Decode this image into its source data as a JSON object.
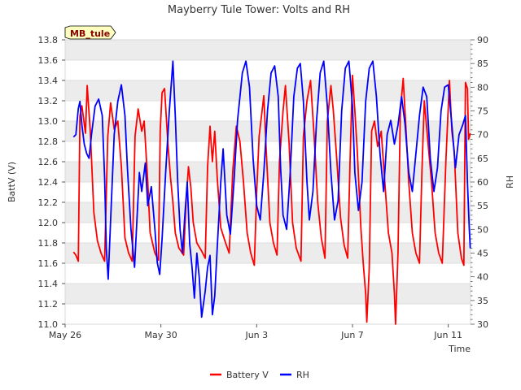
{
  "chart_data": {
    "type": "line",
    "title": "Mayberry Tule Tower: Volts and RH",
    "badge": "MB_tule",
    "xlabel": "Time",
    "ylabel_left": "BattV (V)",
    "ylabel_right": "RH",
    "xlim": [
      "2024-05-26",
      "2024-06-12"
    ],
    "x_ticks": [
      {
        "label": "May 26",
        "day": 0
      },
      {
        "label": "May 30",
        "day": 4
      },
      {
        "label": "Jun 3",
        "day": 8
      },
      {
        "label": "Jun 7",
        "day": 12
      },
      {
        "label": "Jun 11",
        "day": 16
      }
    ],
    "ylim_left": [
      11.0,
      13.8
    ],
    "ylim_right": [
      30,
      90
    ],
    "yticks_left": [
      "11.0",
      "11.2",
      "11.4",
      "11.6",
      "11.8",
      "12.0",
      "12.2",
      "12.4",
      "12.6",
      "12.8",
      "13.0",
      "13.2",
      "13.4",
      "13.6",
      "13.8"
    ],
    "yticks_right": [
      "30",
      "35",
      "40",
      "45",
      "50",
      "55",
      "60",
      "65",
      "70",
      "75",
      "80",
      "85",
      "90"
    ],
    "legend_position": "bottom",
    "colors": {
      "battery": "#ff0000",
      "rh": "#0000ff",
      "band": "#ececec",
      "badge_bg": "#ffffc0"
    },
    "series": [
      {
        "name": "Battery V",
        "axis": "left",
        "color": "#ff0000",
        "points": [
          [
            0.35,
            11.71
          ],
          [
            0.45,
            11.68
          ],
          [
            0.55,
            11.62
          ],
          [
            0.62,
            13.05
          ],
          [
            0.7,
            13.15
          ],
          [
            0.85,
            12.88
          ],
          [
            0.92,
            13.35
          ],
          [
            1.05,
            12.9
          ],
          [
            1.2,
            12.1
          ],
          [
            1.35,
            11.82
          ],
          [
            1.5,
            11.7
          ],
          [
            1.65,
            11.62
          ],
          [
            1.78,
            12.85
          ],
          [
            1.9,
            13.18
          ],
          [
            2.05,
            12.92
          ],
          [
            2.2,
            13.0
          ],
          [
            2.35,
            12.55
          ],
          [
            2.5,
            11.85
          ],
          [
            2.65,
            11.7
          ],
          [
            2.8,
            11.62
          ],
          [
            2.92,
            12.85
          ],
          [
            3.05,
            13.12
          ],
          [
            3.2,
            12.9
          ],
          [
            3.3,
            13.0
          ],
          [
            3.45,
            12.4
          ],
          [
            3.55,
            11.9
          ],
          [
            3.75,
            11.7
          ],
          [
            3.9,
            11.63
          ],
          [
            3.97,
            12.9
          ],
          [
            4.05,
            13.28
          ],
          [
            4.15,
            13.32
          ],
          [
            4.3,
            12.75
          ],
          [
            4.4,
            12.45
          ],
          [
            4.5,
            12.2
          ],
          [
            4.6,
            11.9
          ],
          [
            4.75,
            11.75
          ],
          [
            4.95,
            11.68
          ],
          [
            5.05,
            12.2
          ],
          [
            5.15,
            12.55
          ],
          [
            5.25,
            12.35
          ],
          [
            5.35,
            12.0
          ],
          [
            5.5,
            11.8
          ],
          [
            5.7,
            11.72
          ],
          [
            5.85,
            11.65
          ],
          [
            5.95,
            12.55
          ],
          [
            6.05,
            12.95
          ],
          [
            6.15,
            12.6
          ],
          [
            6.25,
            12.9
          ],
          [
            6.35,
            12.45
          ],
          [
            6.5,
            11.95
          ],
          [
            6.7,
            11.8
          ],
          [
            6.85,
            11.7
          ],
          [
            7.0,
            12.5
          ],
          [
            7.15,
            12.95
          ],
          [
            7.3,
            12.8
          ],
          [
            7.45,
            12.4
          ],
          [
            7.6,
            11.9
          ],
          [
            7.75,
            11.7
          ],
          [
            7.9,
            11.58
          ],
          [
            8.0,
            12.3
          ],
          [
            8.1,
            12.85
          ],
          [
            8.2,
            13.05
          ],
          [
            8.3,
            13.25
          ],
          [
            8.4,
            12.7
          ],
          [
            8.55,
            12.0
          ],
          [
            8.7,
            11.8
          ],
          [
            8.85,
            11.68
          ],
          [
            8.95,
            12.6
          ],
          [
            9.1,
            13.1
          ],
          [
            9.2,
            13.35
          ],
          [
            9.35,
            12.8
          ],
          [
            9.5,
            12.0
          ],
          [
            9.65,
            11.75
          ],
          [
            9.85,
            11.62
          ],
          [
            9.95,
            12.85
          ],
          [
            10.1,
            13.2
          ],
          [
            10.25,
            13.4
          ],
          [
            10.4,
            12.85
          ],
          [
            10.55,
            12.2
          ],
          [
            10.7,
            11.85
          ],
          [
            10.85,
            11.65
          ],
          [
            10.95,
            13.0
          ],
          [
            11.1,
            13.35
          ],
          [
            11.2,
            13.1
          ],
          [
            11.35,
            12.6
          ],
          [
            11.5,
            12.05
          ],
          [
            11.65,
            11.78
          ],
          [
            11.8,
            11.65
          ],
          [
            11.9,
            12.6
          ],
          [
            12.0,
            13.45
          ],
          [
            12.1,
            13.1
          ],
          [
            12.2,
            12.7
          ],
          [
            12.35,
            11.95
          ],
          [
            12.45,
            11.6
          ],
          [
            12.55,
            11.3
          ],
          [
            12.6,
            11.02
          ],
          [
            12.7,
            11.55
          ],
          [
            12.8,
            12.9
          ],
          [
            12.92,
            13.0
          ],
          [
            13.05,
            12.75
          ],
          [
            13.2,
            12.9
          ],
          [
            13.35,
            12.4
          ],
          [
            13.5,
            11.9
          ],
          [
            13.65,
            11.7
          ],
          [
            13.75,
            11.3
          ],
          [
            13.8,
            11.0
          ],
          [
            13.9,
            11.7
          ],
          [
            14.0,
            13.1
          ],
          [
            14.12,
            13.42
          ],
          [
            14.25,
            12.85
          ],
          [
            14.35,
            12.4
          ],
          [
            14.5,
            11.9
          ],
          [
            14.65,
            11.7
          ],
          [
            14.8,
            11.6
          ],
          [
            14.9,
            12.5
          ],
          [
            15.0,
            13.2
          ],
          [
            15.15,
            12.8
          ],
          [
            15.3,
            12.4
          ],
          [
            15.45,
            11.9
          ],
          [
            15.6,
            11.7
          ],
          [
            15.75,
            11.6
          ],
          [
            15.9,
            12.6
          ],
          [
            16.05,
            13.4
          ],
          [
            16.15,
            12.9
          ],
          [
            16.25,
            12.7
          ],
          [
            16.4,
            11.9
          ],
          [
            16.55,
            11.65
          ],
          [
            16.65,
            11.58
          ],
          [
            16.72,
            13.38
          ],
          [
            16.8,
            13.32
          ],
          [
            16.85,
            12.82
          ],
          [
            16.92,
            12.88
          ]
        ]
      },
      {
        "name": "RH",
        "axis": "right",
        "color": "#0000ff",
        "points": [
          [
            0.35,
            69.5
          ],
          [
            0.45,
            70.0
          ],
          [
            0.55,
            75.5
          ],
          [
            0.62,
            77.0
          ],
          [
            0.7,
            72.0
          ],
          [
            0.8,
            68.0
          ],
          [
            0.9,
            66.0
          ],
          [
            1.0,
            65.0
          ],
          [
            1.1,
            70.0
          ],
          [
            1.25,
            76.0
          ],
          [
            1.4,
            77.5
          ],
          [
            1.55,
            74.0
          ],
          [
            1.65,
            61.0
          ],
          [
            1.72,
            46.0
          ],
          [
            1.8,
            39.5
          ],
          [
            1.9,
            52.0
          ],
          [
            2.05,
            70.0
          ],
          [
            2.2,
            77.0
          ],
          [
            2.35,
            80.5
          ],
          [
            2.5,
            74.0
          ],
          [
            2.6,
            63.0
          ],
          [
            2.75,
            50.0
          ],
          [
            2.9,
            42.0
          ],
          [
            3.0,
            52.0
          ],
          [
            3.1,
            62.0
          ],
          [
            3.2,
            58.0
          ],
          [
            3.35,
            64.0
          ],
          [
            3.45,
            55.0
          ],
          [
            3.6,
            59.0
          ],
          [
            3.75,
            50.0
          ],
          [
            3.85,
            43.0
          ],
          [
            3.95,
            40.5
          ],
          [
            4.05,
            48.0
          ],
          [
            4.2,
            62.0
          ],
          [
            4.35,
            75.0
          ],
          [
            4.5,
            85.5
          ],
          [
            4.6,
            74.0
          ],
          [
            4.7,
            60.0
          ],
          [
            4.8,
            50.0
          ],
          [
            4.9,
            45.0
          ],
          [
            5.0,
            53.0
          ],
          [
            5.1,
            60.0
          ],
          [
            5.2,
            47.0
          ],
          [
            5.3,
            42.0
          ],
          [
            5.4,
            35.5
          ],
          [
            5.5,
            45.0
          ],
          [
            5.6,
            40.0
          ],
          [
            5.7,
            31.5
          ],
          [
            5.85,
            37.0
          ],
          [
            5.95,
            42.0
          ],
          [
            6.05,
            44.5
          ],
          [
            6.15,
            32.0
          ],
          [
            6.25,
            36.0
          ],
          [
            6.35,
            46.0
          ],
          [
            6.5,
            60.0
          ],
          [
            6.6,
            67.0
          ],
          [
            6.75,
            53.0
          ],
          [
            6.9,
            49.0
          ],
          [
            7.05,
            60.0
          ],
          [
            7.2,
            73.0
          ],
          [
            7.4,
            83.0
          ],
          [
            7.55,
            85.5
          ],
          [
            7.7,
            80.0
          ],
          [
            7.85,
            65.0
          ],
          [
            8.0,
            55.0
          ],
          [
            8.15,
            52.0
          ],
          [
            8.3,
            62.0
          ],
          [
            8.45,
            75.0
          ],
          [
            8.6,
            83.0
          ],
          [
            8.75,
            84.5
          ],
          [
            8.9,
            78.0
          ],
          [
            9.0,
            63.0
          ],
          [
            9.1,
            53.0
          ],
          [
            9.25,
            50.0
          ],
          [
            9.4,
            62.0
          ],
          [
            9.55,
            78.0
          ],
          [
            9.7,
            84.0
          ],
          [
            9.82,
            85.0
          ],
          [
            9.95,
            77.0
          ],
          [
            10.1,
            60.0
          ],
          [
            10.2,
            52.0
          ],
          [
            10.35,
            58.0
          ],
          [
            10.5,
            73.0
          ],
          [
            10.65,
            83.0
          ],
          [
            10.8,
            85.5
          ],
          [
            10.95,
            76.0
          ],
          [
            11.1,
            62.0
          ],
          [
            11.25,
            52.0
          ],
          [
            11.4,
            56.0
          ],
          [
            11.55,
            75.0
          ],
          [
            11.7,
            84.0
          ],
          [
            11.85,
            85.5
          ],
          [
            12.0,
            76.0
          ],
          [
            12.1,
            62.0
          ],
          [
            12.25,
            54.0
          ],
          [
            12.4,
            60.0
          ],
          [
            12.55,
            77.0
          ],
          [
            12.7,
            84.0
          ],
          [
            12.85,
            85.5
          ],
          [
            13.0,
            78.0
          ],
          [
            13.15,
            66.0
          ],
          [
            13.3,
            58.0
          ],
          [
            13.45,
            70.0
          ],
          [
            13.6,
            73.0
          ],
          [
            13.75,
            68.0
          ],
          [
            13.9,
            72.0
          ],
          [
            14.05,
            78.0
          ],
          [
            14.2,
            72.0
          ],
          [
            14.35,
            62.0
          ],
          [
            14.5,
            58.0
          ],
          [
            14.65,
            66.0
          ],
          [
            14.8,
            74.0
          ],
          [
            14.95,
            80.0
          ],
          [
            15.1,
            78.0
          ],
          [
            15.25,
            65.0
          ],
          [
            15.4,
            58.0
          ],
          [
            15.55,
            63.0
          ],
          [
            15.7,
            75.0
          ],
          [
            15.85,
            80.0
          ],
          [
            16.0,
            80.5
          ],
          [
            16.15,
            72.0
          ],
          [
            16.3,
            63.0
          ],
          [
            16.45,
            70.0
          ],
          [
            16.6,
            72.0
          ],
          [
            16.72,
            74.0
          ],
          [
            16.8,
            60.0
          ],
          [
            16.88,
            50.0
          ],
          [
            16.92,
            46.0
          ]
        ]
      }
    ]
  }
}
